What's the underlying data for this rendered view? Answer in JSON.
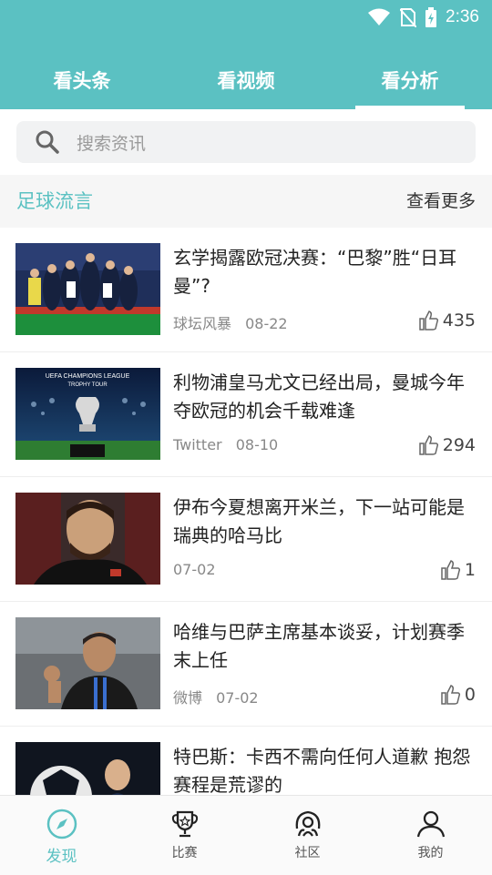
{
  "status_bar": {
    "time": "2:36"
  },
  "tabs": [
    {
      "label": "看头条"
    },
    {
      "label": "看视频"
    },
    {
      "label": "看分析"
    }
  ],
  "active_tab": 2,
  "search": {
    "placeholder": "搜索资讯"
  },
  "section": {
    "title": "足球流言",
    "more": "查看更多"
  },
  "articles": [
    {
      "title": "玄学揭露欧冠决赛：“巴黎”胜“日耳曼”?",
      "source": "球坛风暴",
      "date": "08-22",
      "likes": "435"
    },
    {
      "title": "利物浦皇马尤文已经出局，曼城今年夺欧冠的机会千载难逢",
      "source": "Twitter",
      "date": "08-10",
      "likes": "294"
    },
    {
      "title": "伊布今夏想离开米兰，下一站可能是瑞典的哈马比",
      "source": "",
      "date": "07-02",
      "likes": "1"
    },
    {
      "title": "哈维与巴萨主席基本谈妥，计划赛季末上任",
      "source": "微博",
      "date": "07-02",
      "likes": "0"
    },
    {
      "title": "特巴斯：卡西不需向任何人道歉 抱怨赛程是荒谬的",
      "source": "",
      "date": "",
      "likes": ""
    }
  ],
  "thumb_text": {
    "ucl": "UEFA CHAMPIONS LEAGUE",
    "trophy_tour": "TROPHY TOUR"
  },
  "bottom_nav": [
    {
      "label": "发现",
      "icon": "compass-icon"
    },
    {
      "label": "比赛",
      "icon": "trophy-icon"
    },
    {
      "label": "社区",
      "icon": "community-icon"
    },
    {
      "label": "我的",
      "icon": "user-icon"
    }
  ],
  "colors": {
    "accent": "#5bc1c2",
    "text": "#222222",
    "meta": "#888888"
  }
}
